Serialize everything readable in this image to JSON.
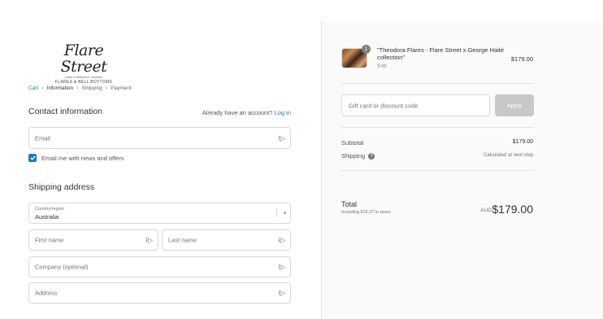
{
  "logo": {
    "main": "Flare Street",
    "tagline": "Made in Melbourne, Australia",
    "subtitle": "FLARES & BELL BOTTOMS"
  },
  "breadcrumb": {
    "cart": "Cart",
    "information": "Information",
    "shipping": "Shipping",
    "payment": "Payment"
  },
  "contact": {
    "title": "Contact information",
    "account_prompt": "Already have an account?",
    "login_link": "Log in",
    "email_placeholder": "Email",
    "newsletter_label": "Email me with news and offers",
    "newsletter_checked": true
  },
  "shipping": {
    "title": "Shipping address",
    "country_label": "Country/region",
    "country_value": "Australia",
    "first_name_placeholder": "First name",
    "last_name_placeholder": "Last name",
    "company_placeholder": "Company (optional)",
    "address_placeholder": "Address"
  },
  "summary": {
    "item_quantity": "1",
    "item_name": "\"Theodora Flares - Flare Street x George Haité collection\"",
    "item_variant": "S-M",
    "item_price": "$179.00",
    "discount_placeholder": "Gift card or discount code",
    "apply_label": "Apply",
    "subtotal_label": "Subtotal",
    "subtotal_value": "$179.00",
    "shipping_label": "Shipping",
    "shipping_value": "Calculated at next step",
    "total_label": "Total",
    "taxes_note": "Including $16.27 in taxes",
    "currency": "AUD",
    "total_value": "$179.00"
  },
  "colors": {
    "accent": "#197bbd",
    "apply_disabled": "#c8c8c8",
    "summary_bg": "#fafafa"
  }
}
